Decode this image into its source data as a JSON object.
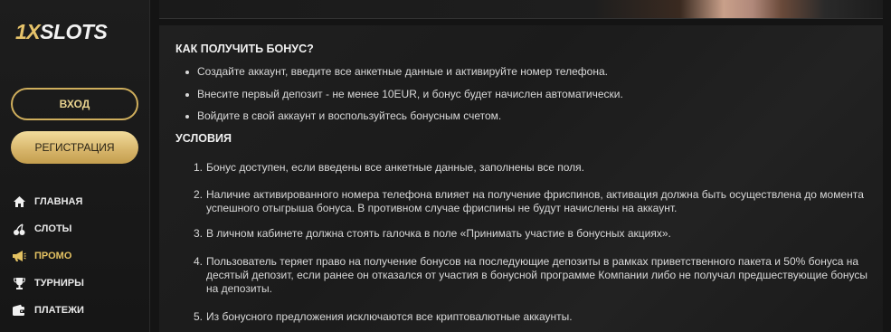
{
  "sidebar": {
    "logo_prefix": "1X",
    "logo_suffix": "SLOTS",
    "login_label": "ВХОД",
    "register_label": "РЕГИСТРАЦИЯ",
    "nav": [
      {
        "label": "ГЛАВНАЯ",
        "icon": "home-icon"
      },
      {
        "label": "СЛОТЫ",
        "icon": "cherries-icon"
      },
      {
        "label": "ПРОМО",
        "icon": "megaphone-icon",
        "active": true
      },
      {
        "label": "ТУРНИРЫ",
        "icon": "trophy-icon"
      },
      {
        "label": "ПЛАТЕЖИ",
        "icon": "wallet-icon"
      }
    ],
    "accent_color": "#e4c262"
  },
  "content": {
    "how_title": "КАК ПОЛУЧИТЬ БОНУС?",
    "how_items": [
      "Создайте аккаунт, введите все анкетные данные и активируйте номер телефона.",
      "Внесите первый депозит - не менее 10EUR, и бонус будет начислен автоматически.",
      "Войдите в свой аккаунт и воспользуйтесь бонусным счетом."
    ],
    "conditions_title": "УСЛОВИЯ",
    "conditions": [
      {
        "n": "1.",
        "text": "Бонус доступен, если введены все анкетные данные, заполнены все поля."
      },
      {
        "n": "2.",
        "text": "Наличие активированного номера телефона влияет на получение фриспинов, активация должна быть осуществлена до моментa успешного отыгрыша бонуса. В противном случае фриспины не будут начислены на аккаунт."
      },
      {
        "n": "3.",
        "text": "В личном кабинете должна стоять галочка в поле «Принимать участие в бонусных акциях»."
      },
      {
        "n": "4.",
        "text": "Пользователь теряет право на получение бонусов на последующие депозиты в рамках приветственного пакета и 50% бонуса на десятый депозит, если ранее он отказался от участия в бонусной программе Компании либо не получал предшествующие бонусы на депозиты."
      },
      {
        "n": "5.",
        "text": "Из бонусного предложения исключаются все криптовалютные аккаунты."
      }
    ]
  }
}
